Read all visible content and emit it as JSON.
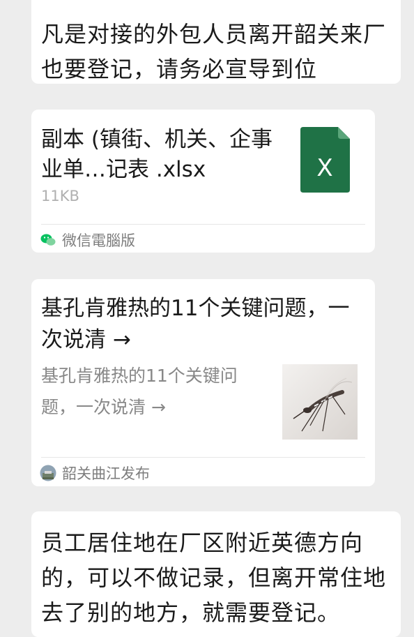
{
  "messages": {
    "top_text": "凡是对接的外包人员离开韶关来厂也要登记，请务必宣导到位",
    "file_card": {
      "filename": "副本 (镇街、机关、企事业单…记表 .xlsx",
      "size": "11KB",
      "source": "微信電腦版",
      "file_icon": "excel-file-icon",
      "file_icon_letter": "X",
      "file_icon_color": "#1f7246"
    },
    "article_card": {
      "title": "基孔肯雅热的11个关键问题，一次说清 →",
      "description": "基孔肯雅热的11个关键问题，一次说清 →",
      "thumbnail": "mosquito-image",
      "source": "韶关曲江发布"
    },
    "bottom_text": "员工居住地在厂区附近英德方向的，可以不做记录，但离开常住地去了别的地方，就需要登记。"
  },
  "colors": {
    "background": "#ededed",
    "bubble": "#ffffff",
    "wechat_green": "#07c160"
  }
}
